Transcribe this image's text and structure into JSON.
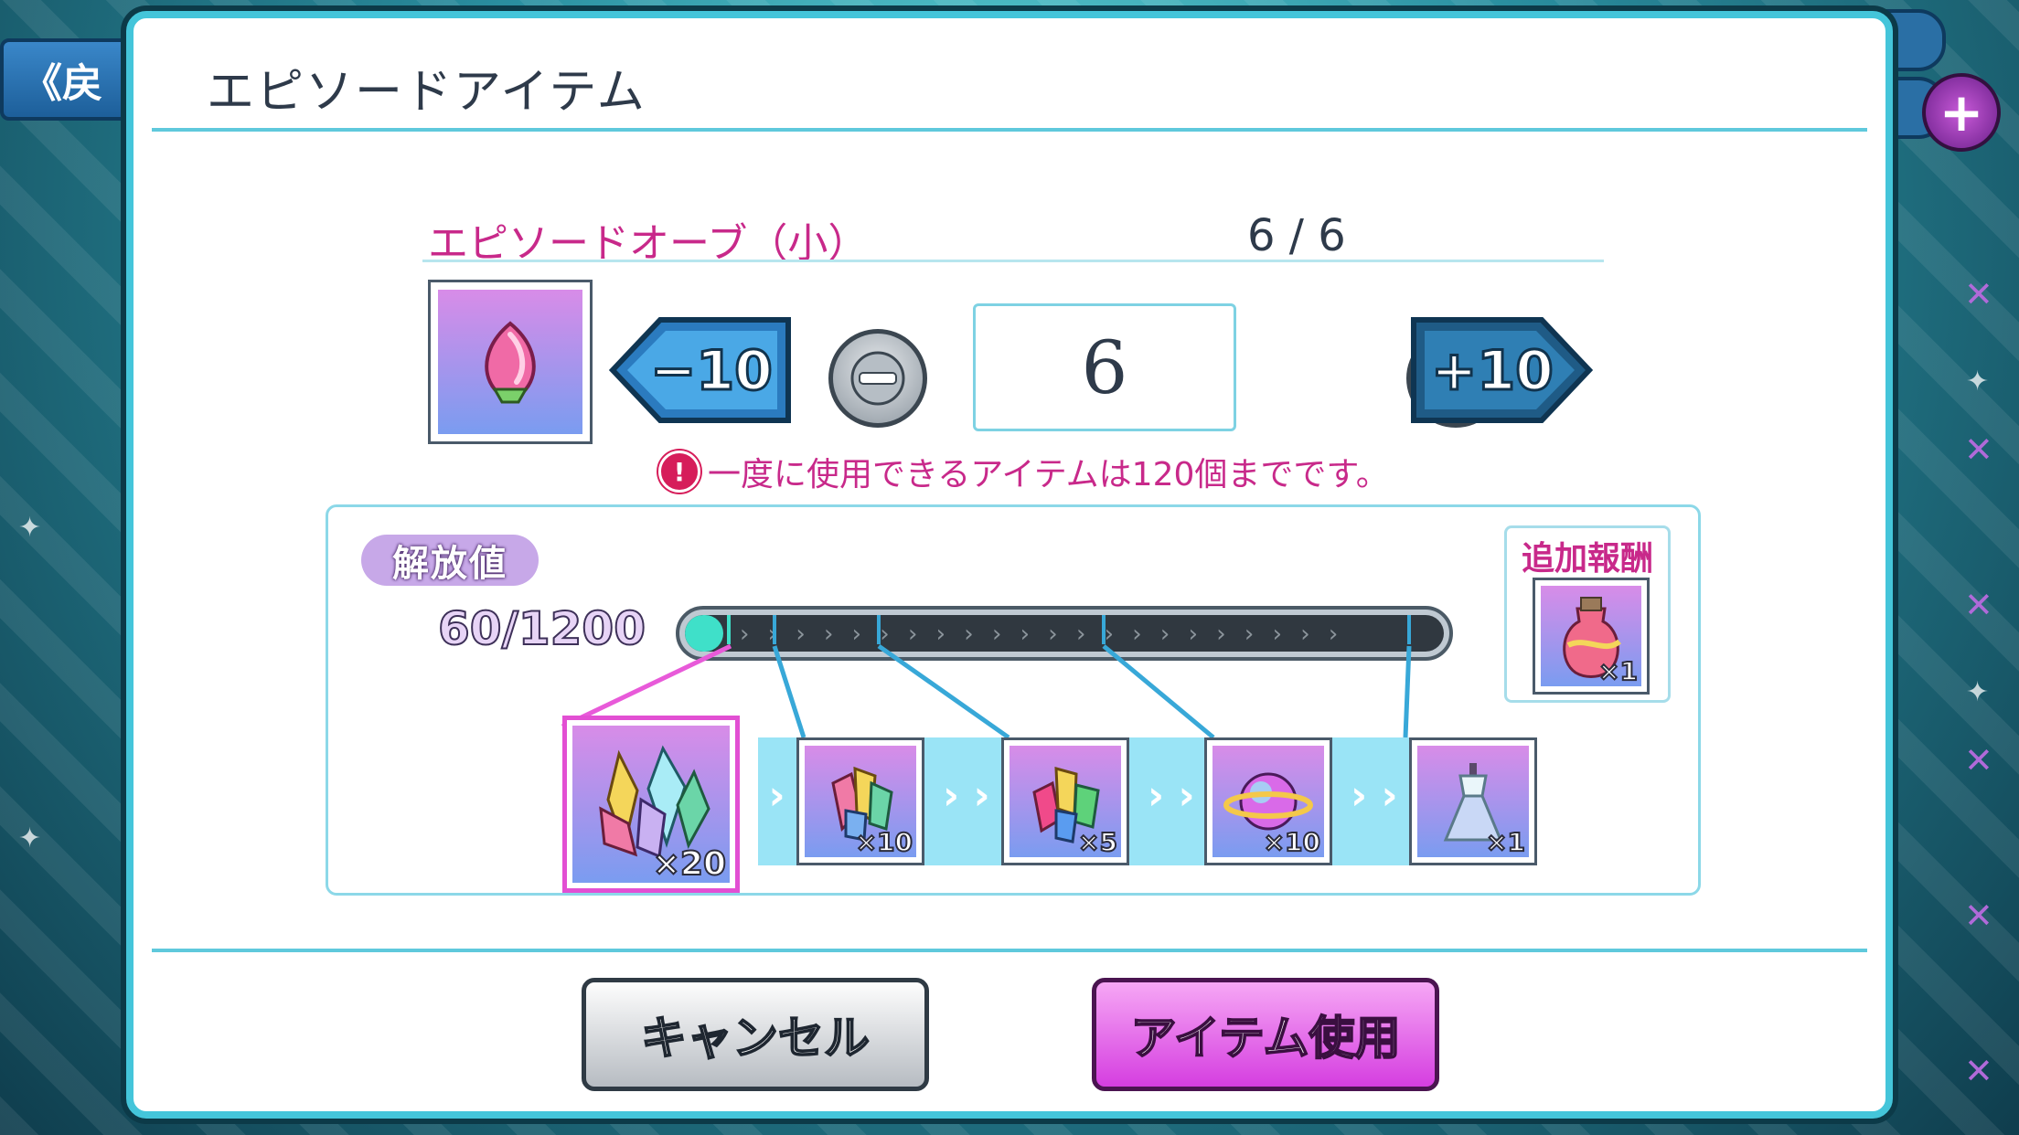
{
  "background": {
    "back_label": "《戻",
    "plus_symbol": "+"
  },
  "dialog": {
    "title": "エピソードアイテム",
    "item": {
      "name": "エピソードオーブ（小）",
      "owned": "6 / 6"
    },
    "controls": {
      "minus10_label": "−10",
      "plus10_label": "+10",
      "minus_symbol": "−",
      "plus_symbol": "+",
      "quantity": "6"
    },
    "warning": {
      "icon_text": "!",
      "text": "一度に使用できるアイテムは120個までです。"
    },
    "release": {
      "badge_label": "解放値",
      "value_text": "60/1200",
      "current": 60,
      "max": 1200
    },
    "extra_reward": {
      "label": "追加報酬",
      "quantity": "×1"
    },
    "rewards": [
      {
        "icon": "crystal-cluster-large",
        "quantity": "×20"
      },
      {
        "icon": "crystal-gems",
        "quantity": "×10"
      },
      {
        "icon": "crystal-mixed",
        "quantity": "×5"
      },
      {
        "icon": "planet-orb",
        "quantity": "×10"
      },
      {
        "icon": "dress",
        "quantity": "×1"
      }
    ],
    "buttons": {
      "cancel": "キャンセル",
      "use": "アイテム使用"
    }
  },
  "colors": {
    "accent_pink": "#c8298a",
    "border_cyan": "#44c5da",
    "use_button": "#d53ee0"
  }
}
